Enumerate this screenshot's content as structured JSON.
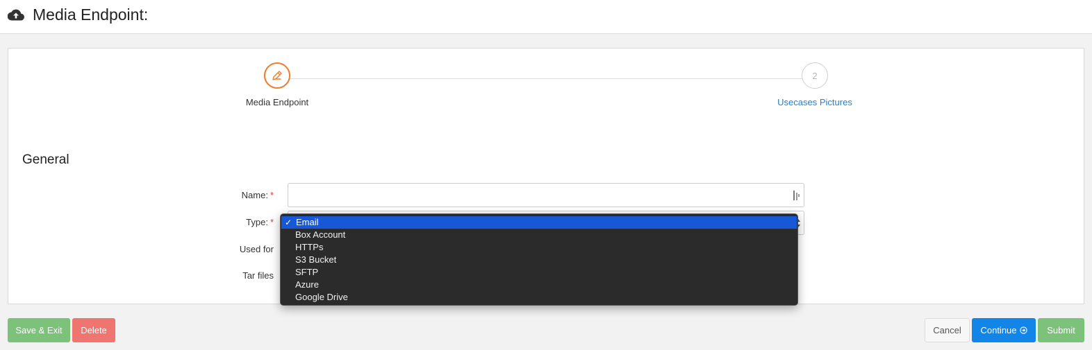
{
  "header": {
    "title": "Media Endpoint:",
    "icon": "cloud-upload-icon"
  },
  "wizard": {
    "steps": [
      {
        "number": "1",
        "label": "Media Endpoint",
        "state": "active",
        "icon": "pencil-icon"
      },
      {
        "number": "2",
        "label": "Usecases Pictures",
        "state": "todo"
      }
    ],
    "accent_color": "#f07c2a"
  },
  "section": {
    "title": "General"
  },
  "form": {
    "name_label": "Name:",
    "name_value": "",
    "type_label": "Type:",
    "used_for_label": "Used for",
    "tar_files_label": "Tar files",
    "required_marker": "*"
  },
  "type_dropdown": {
    "selected": "Email",
    "check_mark": "✓",
    "options": [
      "Email",
      "Box Account",
      "HTTPs",
      "S3 Bucket",
      "SFTP",
      "Azure",
      "Google Drive"
    ]
  },
  "buttons": {
    "save_exit": "Save & Exit",
    "delete": "Delete",
    "cancel": "Cancel",
    "continue": "Continue",
    "submit": "Submit"
  },
  "colors": {
    "success": "#7dc27b",
    "danger": "#ee7570",
    "primary": "#1185e8",
    "link": "#1f7fd1",
    "selected_option": "#1758d8"
  }
}
